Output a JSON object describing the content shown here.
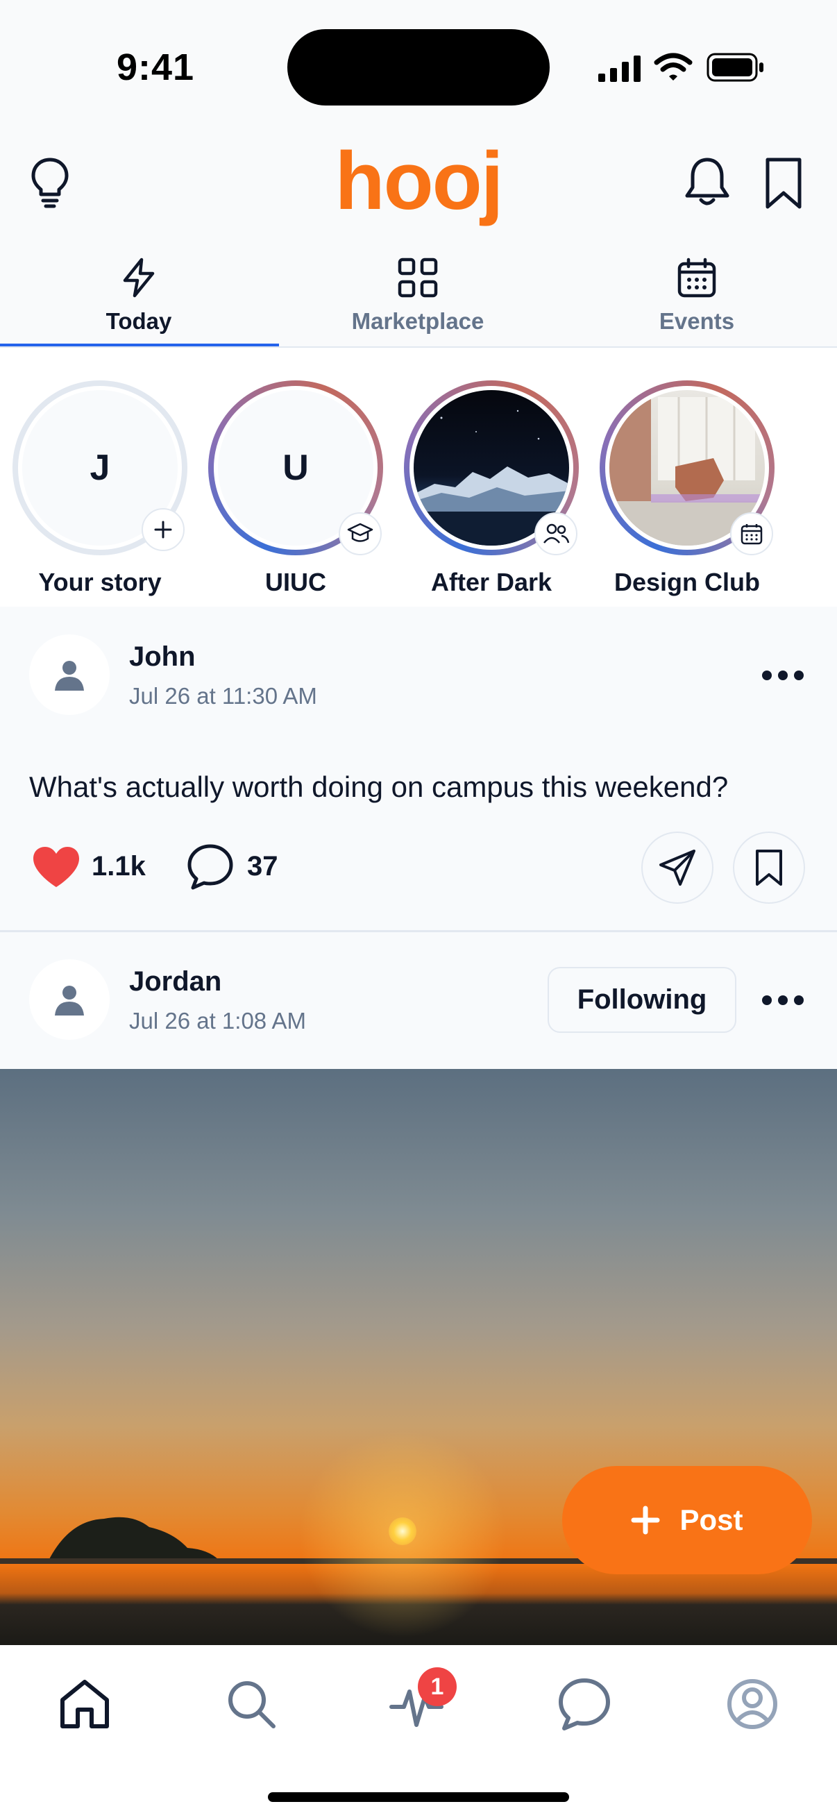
{
  "status_bar": {
    "time": "9:41"
  },
  "header": {
    "logo": "hooj"
  },
  "tabs": [
    {
      "label": "Today",
      "icon": "lightning-icon",
      "active": true
    },
    {
      "label": "Marketplace",
      "icon": "grid-icon",
      "active": false
    },
    {
      "label": "Events",
      "icon": "calendar-icon",
      "active": false
    }
  ],
  "stories": [
    {
      "name": "Your story",
      "initial": "J",
      "badge": "plus-icon"
    },
    {
      "name": "UIUC",
      "initial": "U",
      "badge": "graduation-cap-icon"
    },
    {
      "name": "After Dark",
      "initial": "",
      "badge": "people-icon"
    },
    {
      "name": "Design Club",
      "initial": "",
      "badge": "calendar-icon"
    }
  ],
  "posts": [
    {
      "author": "John",
      "date": "Jul 26 at 11:30 AM",
      "text": "What's actually worth doing on campus this weekend?",
      "likes": "1.1k",
      "comments": "37"
    },
    {
      "author": "Jordan",
      "date": "Jul 26 at 1:08 AM",
      "follow_label": "Following"
    }
  ],
  "fab": {
    "label": "Post"
  },
  "bottom_nav": {
    "items": [
      "home-icon",
      "search-icon",
      "activity-icon",
      "chat-icon",
      "profile-icon"
    ],
    "activity_badge": "1"
  },
  "colors": {
    "accent": "#f97316",
    "active_tab": "#2563eb",
    "like": "#ef4444"
  }
}
